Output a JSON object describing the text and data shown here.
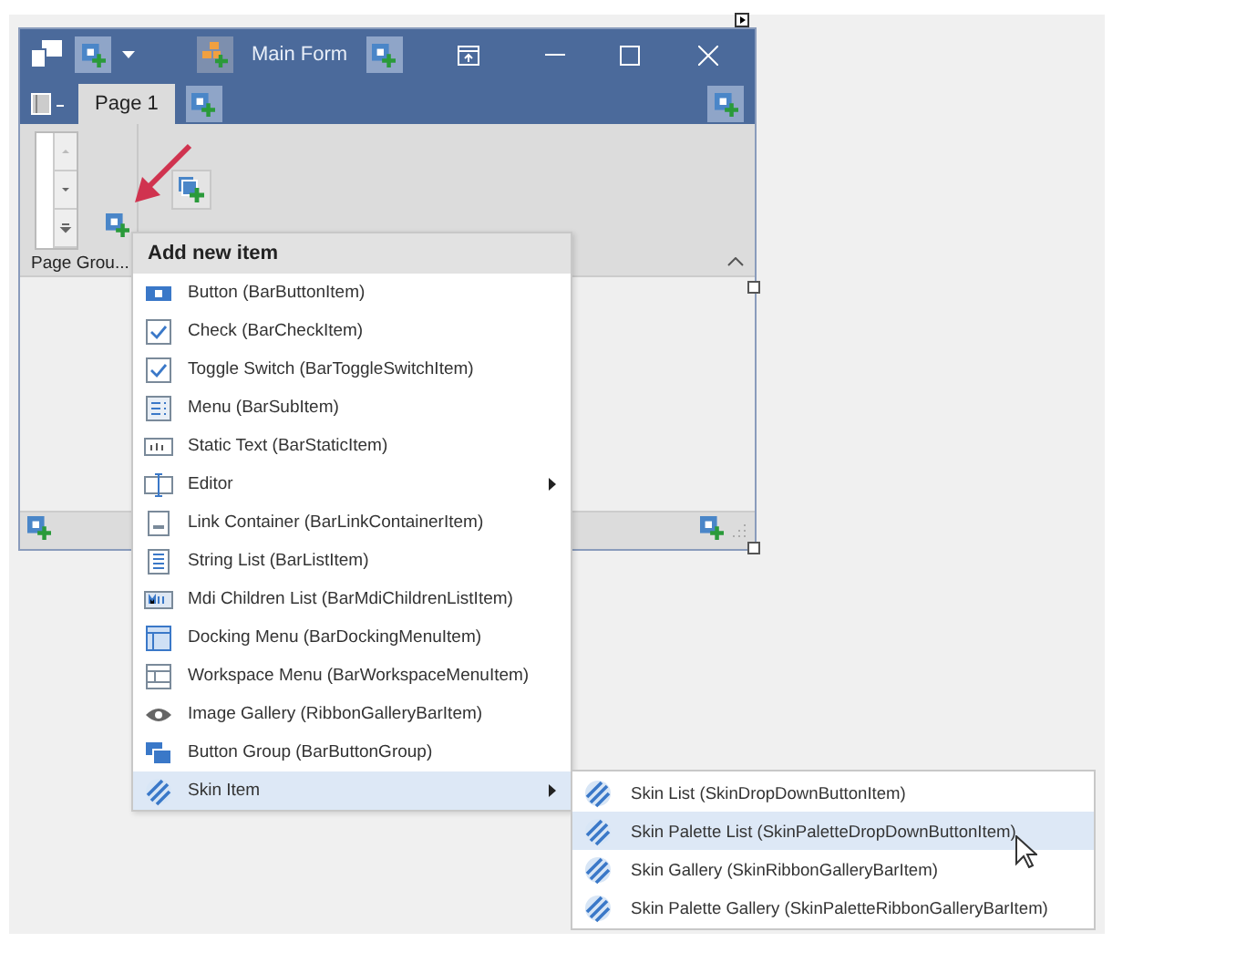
{
  "window": {
    "title": "Main Form"
  },
  "tabs": [
    {
      "label": "Page 1",
      "selected": true
    }
  ],
  "ribbon": {
    "page_group": "Page Grou..."
  },
  "menu": {
    "header": "Add new item",
    "items": [
      {
        "kind": "button",
        "label": "Button (BarButtonItem)",
        "submenu": false,
        "selected": false
      },
      {
        "kind": "check",
        "label": "Check (BarCheckItem)",
        "submenu": false,
        "selected": false
      },
      {
        "kind": "check",
        "label": "Toggle Switch (BarToggleSwitchItem)",
        "submenu": false,
        "selected": false
      },
      {
        "kind": "menu",
        "label": "Menu (BarSubItem)",
        "submenu": false,
        "selected": false
      },
      {
        "kind": "static",
        "label": "Static Text (BarStaticItem)",
        "submenu": false,
        "selected": false
      },
      {
        "kind": "editor",
        "label": "Editor",
        "submenu": true,
        "selected": false
      },
      {
        "kind": "link",
        "label": "Link Container (BarLinkContainerItem)",
        "submenu": false,
        "selected": false
      },
      {
        "kind": "list",
        "label": "String List (BarListItem)",
        "submenu": false,
        "selected": false
      },
      {
        "kind": "mdi",
        "label": "Mdi Children List (BarMdiChildrenListItem)",
        "submenu": false,
        "selected": false
      },
      {
        "kind": "docking",
        "label": "Docking Menu (BarDockingMenuItem)",
        "submenu": false,
        "selected": false
      },
      {
        "kind": "workspace",
        "label": "Workspace Menu (BarWorkspaceMenuItem)",
        "submenu": false,
        "selected": false
      },
      {
        "kind": "gallery",
        "label": "Image Gallery (RibbonGalleryBarItem)",
        "submenu": false,
        "selected": false
      },
      {
        "kind": "group",
        "label": "Button Group (BarButtonGroup)",
        "submenu": false,
        "selected": false
      },
      {
        "kind": "skin",
        "label": "Skin Item",
        "submenu": true,
        "selected": true
      }
    ]
  },
  "submenu": {
    "items": [
      {
        "kind": "skin",
        "label": "Skin List (SkinDropDownButtonItem)",
        "selected": false
      },
      {
        "kind": "skin",
        "label": "Skin Palette List (SkinPaletteDropDownButtonItem)",
        "selected": true
      },
      {
        "kind": "skin",
        "label": "Skin Gallery (SkinRibbonGalleryBarItem)",
        "selected": false
      },
      {
        "kind": "skin",
        "label": "Skin Palette Gallery (SkinPaletteRibbonGalleryBarItem)",
        "selected": false
      }
    ]
  }
}
